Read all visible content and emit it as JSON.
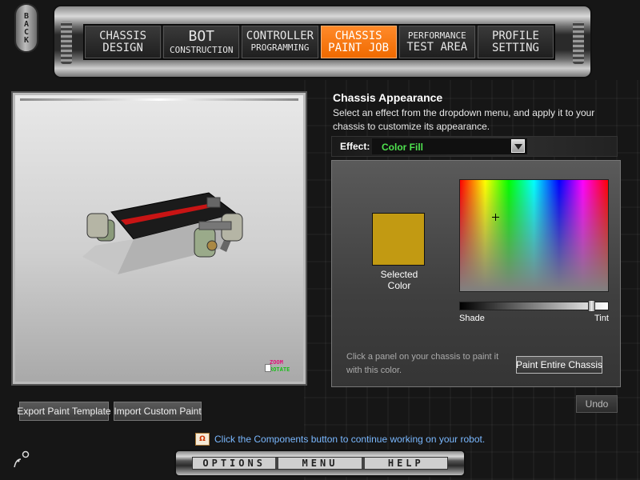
{
  "nav": {
    "back_label": "BACK",
    "tabs": [
      {
        "line1": "CHASSIS",
        "line2": "DESIGN",
        "active": false
      },
      {
        "line1": "BOT",
        "line2": "CONSTRUCTION",
        "active": false
      },
      {
        "line1": "CONTROLLER",
        "line2": "PROGRAMMING",
        "active": false
      },
      {
        "line1": "CHASSIS",
        "line2": "PAINT JOB",
        "active": true
      },
      {
        "line1": "PERFORMANCE",
        "line2": "TEST AREA",
        "active": false
      },
      {
        "line1": "PROFILE",
        "line2": "SETTING",
        "active": false
      }
    ]
  },
  "viewport": {
    "zoom_label": "ZOOM",
    "rotate_label": "ROTATE"
  },
  "buttons": {
    "export_label": "Export Paint Template",
    "import_label": "Import Custom Paint",
    "paint_all_label": "Paint Entire Chassis",
    "undo_label": "Undo"
  },
  "appearance": {
    "title": "Chassis Appearance",
    "description": "Select an effect from the dropdown menu, and apply it to your chassis to customize its appearance.",
    "effect_label": "Effect:",
    "effect_value": "Color Fill",
    "selected_color_label": "Selected Color",
    "selected_color": "#c29a12",
    "shade_label": "Shade",
    "tint_label": "Tint",
    "hint": "Click a panel on your chassis to paint it with this color."
  },
  "status": {
    "icon_text": "Ω",
    "message": "Click the Components button to continue working on your robot."
  },
  "bottom_menu": {
    "options": "OPTIONS",
    "menu": "MENU",
    "help": "HELP"
  },
  "colors": {
    "accent_orange": "#f06a00",
    "effect_green": "#4fe24f",
    "status_blue": "#7ab8ff"
  }
}
